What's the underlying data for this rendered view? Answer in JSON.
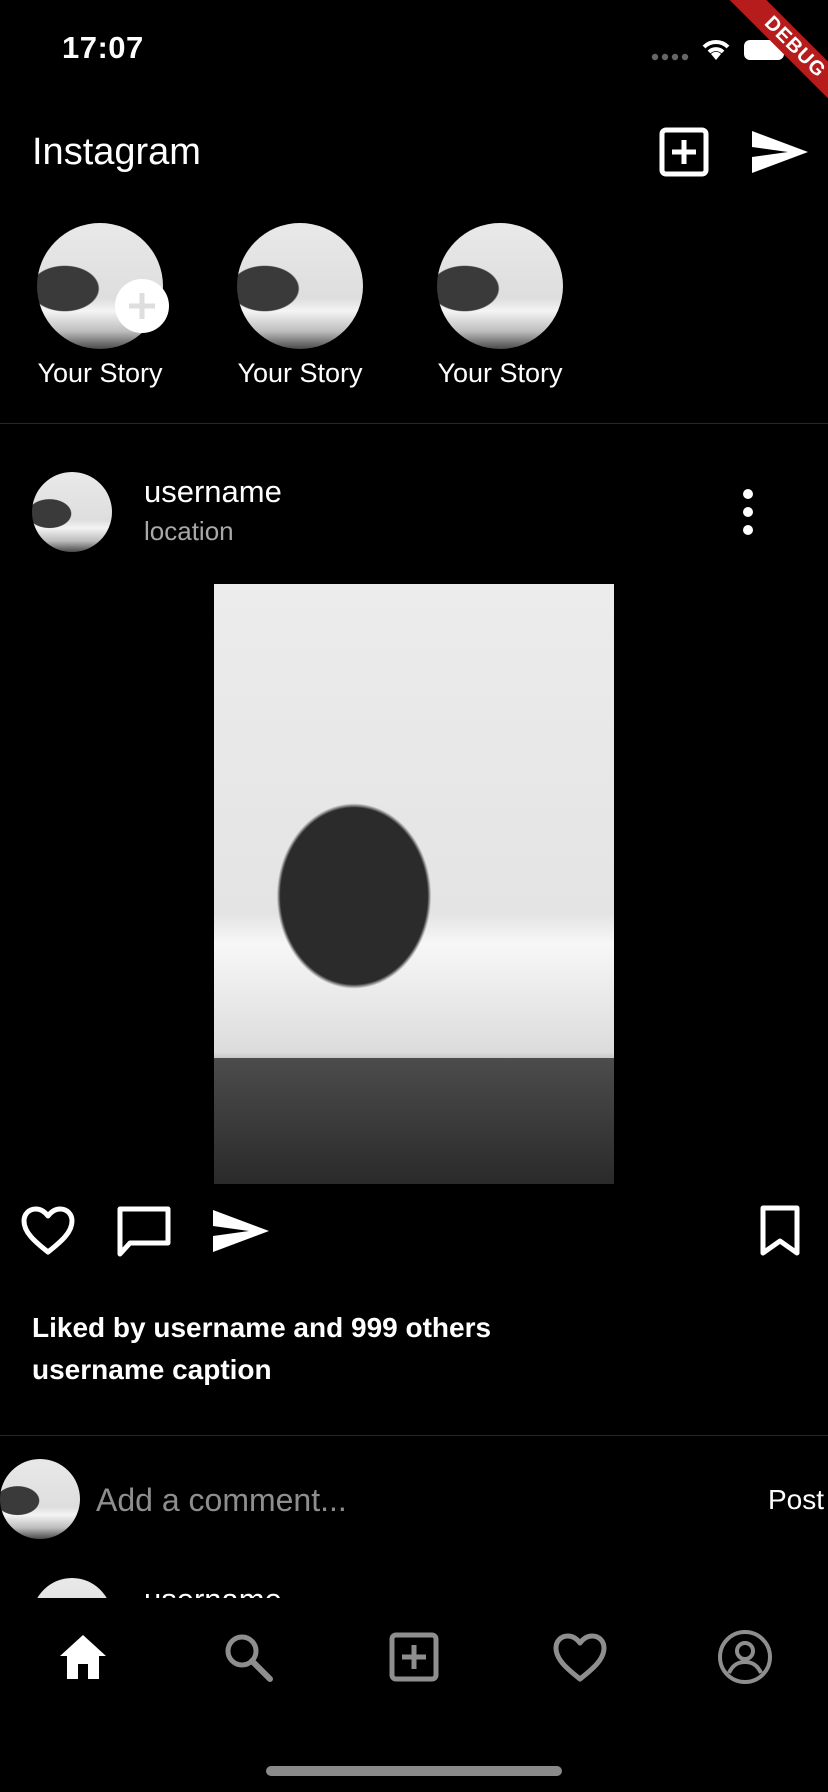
{
  "status_bar": {
    "time": "17:07",
    "debug_banner": "DEBUG"
  },
  "header": {
    "title": "Instagram",
    "new_post_icon": "plus-square-icon",
    "messages_icon": "send-icon"
  },
  "stories": [
    {
      "label": "Your Story",
      "has_add_badge": true
    },
    {
      "label": "Your Story",
      "has_add_badge": false
    },
    {
      "label": "Your Story",
      "has_add_badge": false
    }
  ],
  "post": {
    "username": "username",
    "location": "location",
    "likes_text": "Liked by username and 999 others",
    "caption_text": "username caption",
    "comment_placeholder": "Add a comment...",
    "post_label": "Post",
    "next_username_peek": "username"
  },
  "bottom_nav": {
    "items": [
      "home-icon",
      "search-icon",
      "add-icon",
      "heart-icon",
      "profile-icon"
    ],
    "active": "home-icon"
  },
  "colors": {
    "background": "#000000",
    "text": "#ffffff",
    "muted": "#a8a8a8",
    "divider": "#262626",
    "debug": "#b71c1c"
  }
}
